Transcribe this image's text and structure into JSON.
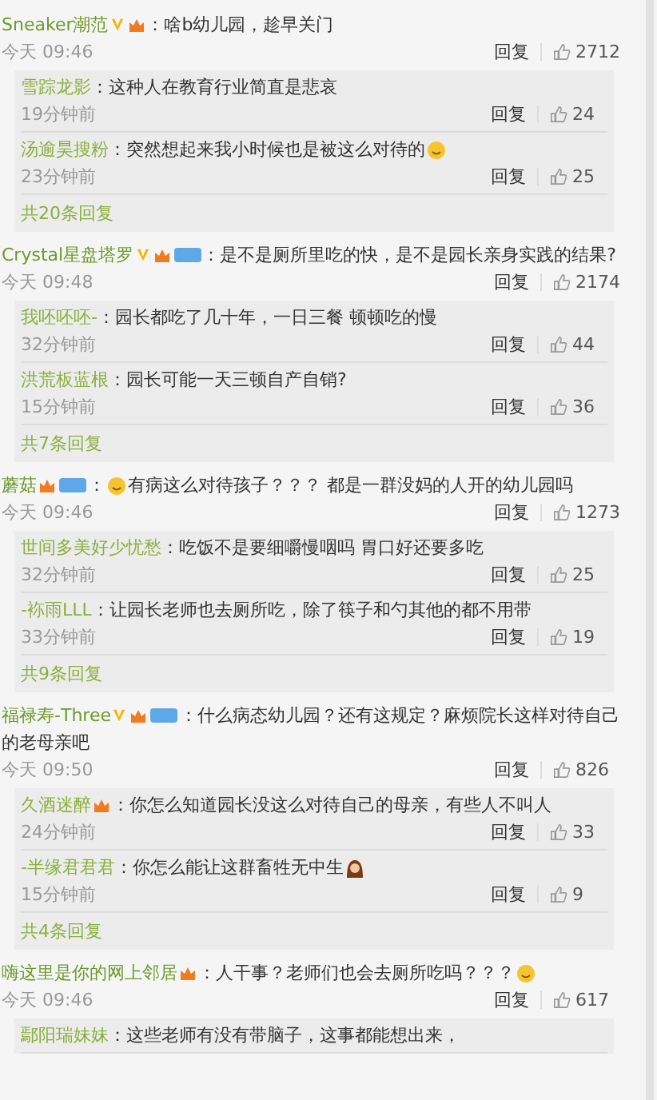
{
  "comments": [
    {
      "user": "Sneaker潮范",
      "badges": [
        {
          "kind": "v"
        },
        {
          "kind": "crown"
        }
      ],
      "segments": [
        {
          "kind": "text",
          "text": "：啥b幼儿园，趁早关门"
        }
      ],
      "time": "今天 09:46",
      "reply": "回复",
      "likes": "2712",
      "replies": [
        {
          "user": "雪踪龙影",
          "segments": [
            {
              "kind": "text",
              "text": "：这种人在教育行业简直是悲哀"
            }
          ],
          "time": "19分钟前",
          "reply": "回复",
          "likes": "24"
        },
        {
          "user": "汤逾昊搜粉",
          "segments": [
            {
              "kind": "text",
              "text": "：突然想起来我小时候也是被这么对待的"
            },
            {
              "kind": "smiley"
            }
          ],
          "time": "23分钟前",
          "reply": "回复",
          "likes": "25"
        }
      ],
      "more": "共20条回复"
    },
    {
      "user": "Crystal星盘塔罗",
      "badges": [
        {
          "kind": "v"
        },
        {
          "kind": "crown"
        },
        {
          "kind": "member"
        }
      ],
      "segments": [
        {
          "kind": "text",
          "text": "：是不是厕所里吃的快，是不是园长亲身实践的结果?"
        }
      ],
      "time": "今天 09:48",
      "reply": "回复",
      "likes": "2174",
      "replies": [
        {
          "user": "我呸呸呸-",
          "segments": [
            {
              "kind": "text",
              "text": "：园长都吃了几十年，一日三餐 顿顿吃的慢"
            }
          ],
          "time": "32分钟前",
          "reply": "回复",
          "likes": "44"
        },
        {
          "user": "洪荒板蓝根",
          "segments": [
            {
              "kind": "text",
              "text": "：园长可能一天三顿自产自销?"
            }
          ],
          "time": "15分钟前",
          "reply": "回复",
          "likes": "36"
        }
      ],
      "more": "共7条回复"
    },
    {
      "user": "蘑菇",
      "badges": [
        {
          "kind": "crown"
        },
        {
          "kind": "member"
        }
      ],
      "segments": [
        {
          "kind": "text",
          "text": "："
        },
        {
          "kind": "smiley"
        },
        {
          "kind": "text",
          "text": "有病这么对待孩子？？？ 都是一群没妈的人开的幼儿园吗"
        }
      ],
      "time": "今天 09:46",
      "reply": "回复",
      "likes": "1273",
      "replies": [
        {
          "user": "世间多美好少忧愁",
          "segments": [
            {
              "kind": "text",
              "text": "：吃饭不是要细嚼慢咽吗 胃口好还要多吃"
            }
          ],
          "time": "32分钟前",
          "reply": "回复",
          "likes": "25"
        },
        {
          "user": "-袮雨LLL",
          "segments": [
            {
              "kind": "text",
              "text": "：让园长老师也去厕所吃，除了筷子和勺其他的都不用带"
            }
          ],
          "time": "33分钟前",
          "reply": "回复",
          "likes": "19"
        }
      ],
      "more": "共9条回复"
    },
    {
      "user": "福禄寿-Three",
      "badges": [
        {
          "kind": "v"
        },
        {
          "kind": "crown"
        },
        {
          "kind": "member"
        }
      ],
      "segments": [
        {
          "kind": "text",
          "text": "：什么病态幼儿园？还有这规定？麻烦院长这样对待自己的老母亲吧"
        }
      ],
      "time": "今天 09:50",
      "reply": "回复",
      "likes": "826",
      "replies": [
        {
          "user": "久酒迷醉",
          "badges": [
            {
              "kind": "crown"
            }
          ],
          "segments": [
            {
              "kind": "text",
              "text": "：你怎么知道园长没这么对待自己的母亲，有些人不叫人"
            }
          ],
          "time": "24分钟前",
          "reply": "回复",
          "likes": "33"
        },
        {
          "user": "-半缘君君君",
          "segments": [
            {
              "kind": "text",
              "text": "：你怎么能让这群畜牲无中生"
            },
            {
              "kind": "girl"
            }
          ],
          "time": "15分钟前",
          "reply": "回复",
          "likes": "9"
        }
      ],
      "more": "共4条回复"
    },
    {
      "user": "嗨这里是你的网上邻居",
      "badges": [
        {
          "kind": "crown"
        }
      ],
      "segments": [
        {
          "kind": "text",
          "text": "：人干事？老师们也会去厕所吃吗？？？"
        },
        {
          "kind": "smiley"
        }
      ],
      "time": "今天 09:46",
      "reply": "回复",
      "likes": "617",
      "replies": [
        {
          "user": "鄢阳瑞妹妹",
          "segments": [
            {
              "kind": "text",
              "text": "：这些老师有没有带脑子，这事都能想出来，"
            }
          ]
        }
      ]
    }
  ]
}
